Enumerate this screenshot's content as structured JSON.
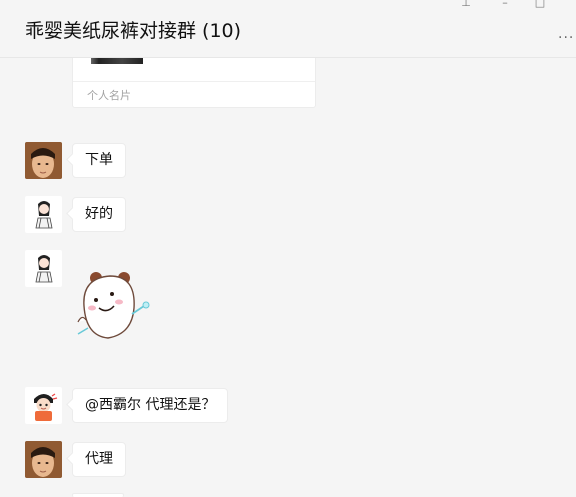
{
  "window": {
    "title": "乖婴美纸尿裤对接群 (10)",
    "controls": {
      "pin": "⊥",
      "minimize": "–",
      "maximize": "□",
      "more": "..."
    }
  },
  "card": {
    "label": "个人名片"
  },
  "messages": [
    {
      "sender_avatar": "man-photo-avatar",
      "text": "下单"
    },
    {
      "sender_avatar": "girl-cartoon-avatar",
      "text": "好的"
    },
    {
      "sender_avatar": "girl-cartoon-avatar",
      "sticker": "bear-sticker"
    },
    {
      "sender_avatar": "cartoon-kid-avatar",
      "mention": "@西霸尔",
      "text": "代理还是？"
    },
    {
      "sender_avatar": "man-photo-avatar",
      "text": "代理"
    }
  ],
  "colors": {
    "background": "#f5f5f5",
    "bubble": "#ffffff",
    "border": "#ececec",
    "muted_text": "#a3a3a3"
  }
}
